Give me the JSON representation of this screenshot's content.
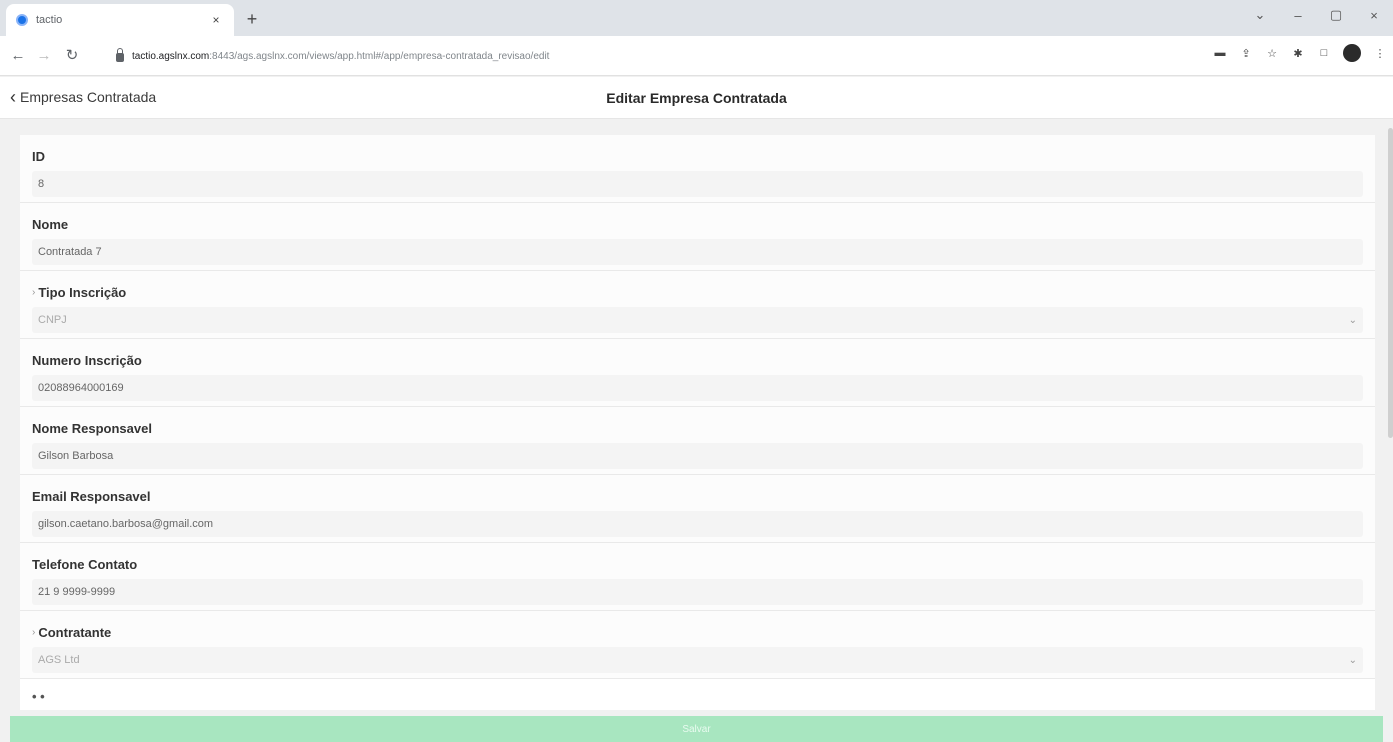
{
  "browser": {
    "tab_title": "tactio",
    "tab_close": "×",
    "new_tab": "+",
    "url_host": "tactio.agslnx.com",
    "url_rest": ":8443/ags.agslnx.com/views/app.html#/app/empresa-contratada_revisao/edit",
    "window_controls": [
      "⌄",
      "–",
      "▢",
      "×"
    ]
  },
  "header": {
    "back_label": "Empresas Contratada",
    "title": "Editar Empresa Contratada"
  },
  "form": {
    "fields": [
      {
        "label": "ID",
        "value": "8"
      },
      {
        "label": "Nome",
        "value": "Contratada 7"
      },
      {
        "label": "Tipo Inscrição",
        "value": "CNPJ"
      },
      {
        "label": "Numero Inscrição",
        "value": "02088964000169"
      },
      {
        "label": "Nome Responsavel",
        "value": "Gilson Barbosa"
      },
      {
        "label": "Email Responsavel",
        "value": "gilson.caetano.barbosa@gmail.com"
      },
      {
        "label": "Telefone Contato",
        "value": "21 9 9999-9999"
      },
      {
        "label": "Contratante",
        "value": "AGS Ltd"
      }
    ],
    "partial_label": "• •"
  },
  "save_button": "Salvar",
  "colors": {
    "accent": "#a8e6c0",
    "tab_favicon": "#1a73e8"
  }
}
